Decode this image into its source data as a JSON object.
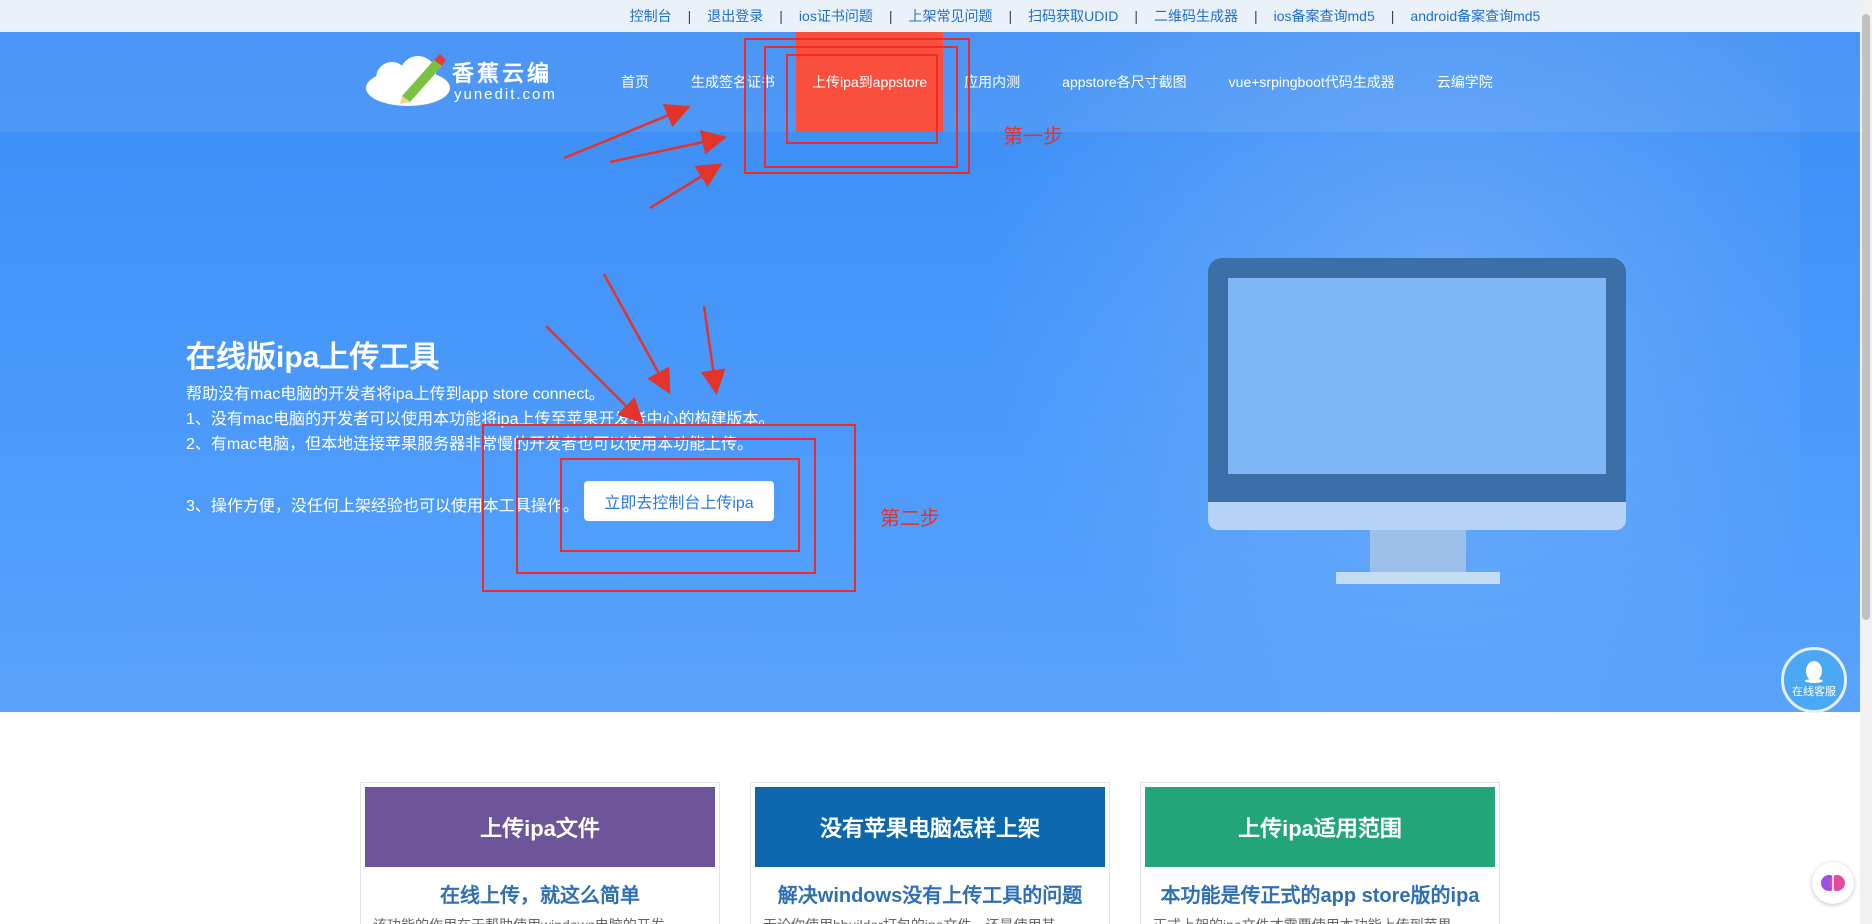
{
  "topbar": {
    "links": [
      "控制台",
      "退出登录",
      "ios证书问题",
      "上架常见问题",
      "扫码获取UDID",
      "二维码生成器",
      "ios备案查询md5",
      "android备案查询md5"
    ],
    "separator": "|"
  },
  "logo": {
    "title": "香蕉云编",
    "subtitle": "yunedit.com"
  },
  "nav": {
    "items": [
      "首页",
      "生成签名证书",
      "上传ipa到appstore",
      "应用内测",
      "appstore各尺寸截图",
      "vue+srpingboot代码生成器",
      "云编学院"
    ],
    "active_index": 2
  },
  "hero": {
    "title": "在线版ipa上传工具",
    "line1": "帮助没有mac电脑的开发者将ipa上传到app store connect。",
    "line2": "1、没有mac电脑的开发者可以使用本功能将ipa上传至苹果开发者中心的构建版本。",
    "line3": "2、有mac电脑，但本地连接苹果服务器非常慢的开发者也可以使用本功能上传。",
    "line4": "3、操作方便，没任何上架经验也可以使用本工具操作。",
    "cta": "立即去控制台上传ipa"
  },
  "annotations": {
    "step1": "第一步",
    "step2": "第二步"
  },
  "customer_service": {
    "label": "在线客服"
  },
  "cards": [
    {
      "head": "上传ipa文件",
      "sub": "在线上传，就这么简单",
      "text": "该功能的作用在于帮助使用windows电脑的开发",
      "color": "#6e5498"
    },
    {
      "head": "没有苹果电脑怎样上架",
      "sub": "解决windows没有上传工具的问题",
      "text": "无论你使用hbuilder打包的ipa文件，还是使用其",
      "color": "#0d67ad"
    },
    {
      "head": "上传ipa适用范围",
      "sub": "本功能是传正式的app store版的ipa",
      "text": "正式上架的ipa文件才需要使用本功能上传到苹果",
      "color": "#21a579"
    }
  ],
  "colors": {
    "hero_blue": "#4a99fb",
    "active_nav": "#fa4f3c",
    "annotation_red": "#e3342b"
  }
}
